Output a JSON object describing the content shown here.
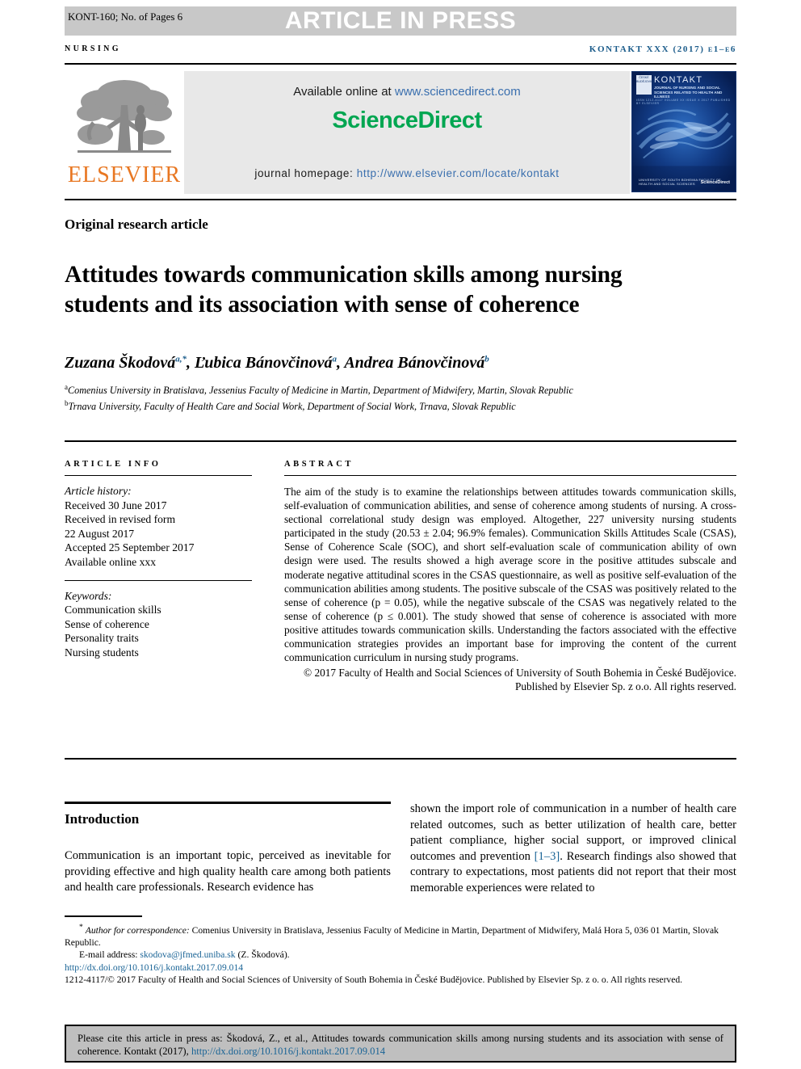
{
  "header": {
    "manuscript_code": "KONT-160; No. of Pages 6",
    "press_banner": "ARTICLE IN PRESS",
    "section_label": "NURSING",
    "journal_ref": "KONTAKT XXX (2017) e1–e6"
  },
  "masthead": {
    "elsevier_wordmark": "ELSEVIER",
    "available_online_prefix": "Available online at ",
    "available_online_link": "www.sciencedirect.com",
    "sciencedirect_logo": "ScienceDirect",
    "homepage_prefix": "journal homepage: ",
    "homepage_link": "http://www.elsevier.com/locate/kontakt",
    "cover": {
      "title": "KONTAKT",
      "subtitle": "JOURNAL OF NURSING AND SOCIAL SCIENCES RELATED TO HEALTH AND ILLNESS",
      "strip": "ISSN 1212-4117   VOLUME XX   ISSUE X   2017   PUBLISHED BY ELSEVIER",
      "badge": "ČESKÉ BUDĚJOVICE",
      "foot_left": "UNIVERSITY OF SOUTH BOHEMIA FACULTY OF HEALTH AND SOCIAL SCIENCES",
      "foot_right": "ScienceDirect"
    }
  },
  "article": {
    "type": "Original research article",
    "title": "Attitudes towards communication skills among nursing students and its association with sense of coherence",
    "authors": [
      {
        "name": "Zuzana Škodová",
        "marks": "a,*"
      },
      {
        "name": "Ľubica Bánovčinová",
        "marks": "a"
      },
      {
        "name": "Andrea Bánovčinová",
        "marks": "b"
      }
    ],
    "affiliations": [
      {
        "mark": "a",
        "text": "Comenius University in Bratislava, Jessenius Faculty of Medicine in Martin, Department of Midwifery, Martin, Slovak Republic"
      },
      {
        "mark": "b",
        "text": "Trnava University, Faculty of Health Care and Social Work, Department of Social Work, Trnava, Slovak Republic"
      }
    ]
  },
  "article_info": {
    "heading": "ARTICLE INFO",
    "history_label": "Article history:",
    "history": [
      "Received 30 June 2017",
      "Received in revised form",
      "22 August 2017",
      "Accepted 25 September 2017",
      "Available online xxx"
    ],
    "keywords_label": "Keywords:",
    "keywords": [
      "Communication skills",
      "Sense of coherence",
      "Personality traits",
      "Nursing students"
    ]
  },
  "abstract": {
    "heading": "ABSTRACT",
    "text": "The aim of the study is to examine the relationships between attitudes towards communication skills, self-evaluation of communication abilities, and sense of coherence among students of nursing. A cross-sectional correlational study design was employed. Altogether, 227 university nursing students participated in the study (20.53 ± 2.04; 96.9% females). Communication Skills Attitudes Scale (CSAS), Sense of Coherence Scale (SOC), and short self-evaluation scale of communication ability of own design were used. The results showed a high average score in the positive attitudes subscale and moderate negative attitudinal scores in the CSAS questionnaire, as well as positive self-evaluation of the communication abilities among students. The positive subscale of the CSAS was positively related to the sense of coherence (p = 0.05), while the negative subscale of the CSAS was negatively related to the sense of coherence (p ≤ 0.001). The study showed that sense of coherence is associated with more positive attitudes towards communication skills. Understanding the factors associated with the effective communication strategies provides an important base for improving the content of the current communication curriculum in nursing study programs.",
    "copyright": "© 2017 Faculty of Health and Social Sciences of University of South Bohemia in České Budějovice. Published by Elsevier Sp. z o.o. All rights reserved."
  },
  "introduction": {
    "heading": "Introduction",
    "left_text": "Communication is an important topic, perceived as inevitable for providing effective and high quality health care among both patients and health care professionals. Research evidence has",
    "right_text_before_ref": "shown the import role of communication in a number of health care related outcomes, such as better utilization of health care, better patient compliance, higher social support, or improved clinical outcomes and prevention ",
    "reference_link": "[1–3]",
    "right_text_after_ref": ". Research findings also showed that contrary to expectations, most patients did not report that their most memorable experiences were related to"
  },
  "footnote": {
    "star": "*",
    "corresponding_label": "Author for correspondence:",
    "corresponding_address": "Comenius University in Bratislava, Jessenius Faculty of Medicine in Martin, Department of Midwifery, Malá Hora 5, 036 01 Martin, Slovak Republic.",
    "email_label": "E-mail address:",
    "email": "skodova@jfmed.uniba.sk",
    "email_owner": "(Z. Škodová).",
    "doi": "http://dx.doi.org/10.1016/j.kontakt.2017.09.014",
    "issn_copyright": "1212-4117/© 2017 Faculty of Health and Social Sciences of University of South Bohemia in České Budějovice. Published by Elsevier Sp. z o. o. All rights reserved."
  },
  "cite_box": {
    "text_before_link": "Please cite this article in press as: Škodová, Z., et al., Attitudes towards communication skills among nursing students and its association with sense of coherence. Kontakt (2017), ",
    "link": "http://dx.doi.org/10.1016/j.kontakt.2017.09.014"
  },
  "colors": {
    "banner_gray": "#c8c8c8",
    "sciencedirect_green": "#00a651",
    "elsevier_orange": "#e87722",
    "link_blue": "#1a6496",
    "journal_ref_blue": "#1a5b8a",
    "cite_box_gray": "#bfbfbf"
  }
}
